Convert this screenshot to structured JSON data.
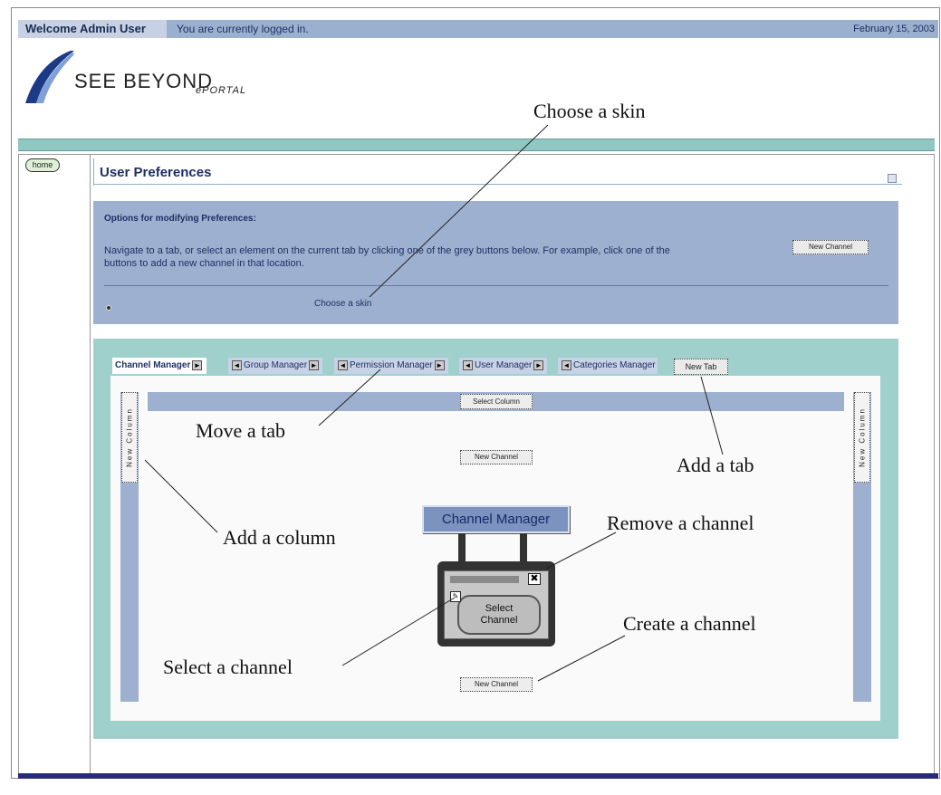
{
  "header": {
    "welcome": "Welcome Admin User",
    "status": "You are currently logged in.",
    "date": "February 15, 2003"
  },
  "logo": {
    "name": "SEE BEYOND",
    "product": "ePORTAL"
  },
  "nav": {
    "home_label": "home"
  },
  "page": {
    "title": "User Preferences"
  },
  "options": {
    "heading": "Options for modifying Preferences:",
    "text": "Navigate to a tab, or select an element on the current tab by clicking one of the grey buttons below. For example, click one of the",
    "text2": "buttons to add a new channel in that location.",
    "new_channel_label": "New Channel",
    "skin_link": "Choose a skin"
  },
  "tabs": [
    {
      "label": "Channel Manager"
    },
    {
      "label": "Group Manager"
    },
    {
      "label": "Permission Manager"
    },
    {
      "label": "User Manager"
    },
    {
      "label": "Categories Manager"
    }
  ],
  "new_tab_label": "New Tab",
  "columns": {
    "new_column_label": "New Column",
    "select_column_label": "Select Column",
    "new_channel_label": "New Channel"
  },
  "channel_graphic": {
    "title": "Channel Manager",
    "select_line1": "Select",
    "select_line2": "Channel",
    "close_glyph": "✖",
    "edit_glyph": "✎"
  },
  "callouts": {
    "choose_skin": "Choose a skin",
    "move_tab": "Move a tab",
    "add_tab": "Add a tab",
    "add_column": "Add a column",
    "remove_channel": "Remove a channel",
    "create_channel": "Create a channel",
    "select_channel": "Select a channel"
  },
  "colors": {
    "header_bar": "#9bb0cf",
    "teal": "#9fd0cc",
    "panel_blue": "#9eb0d0",
    "text_navy": "#1f2f63"
  }
}
